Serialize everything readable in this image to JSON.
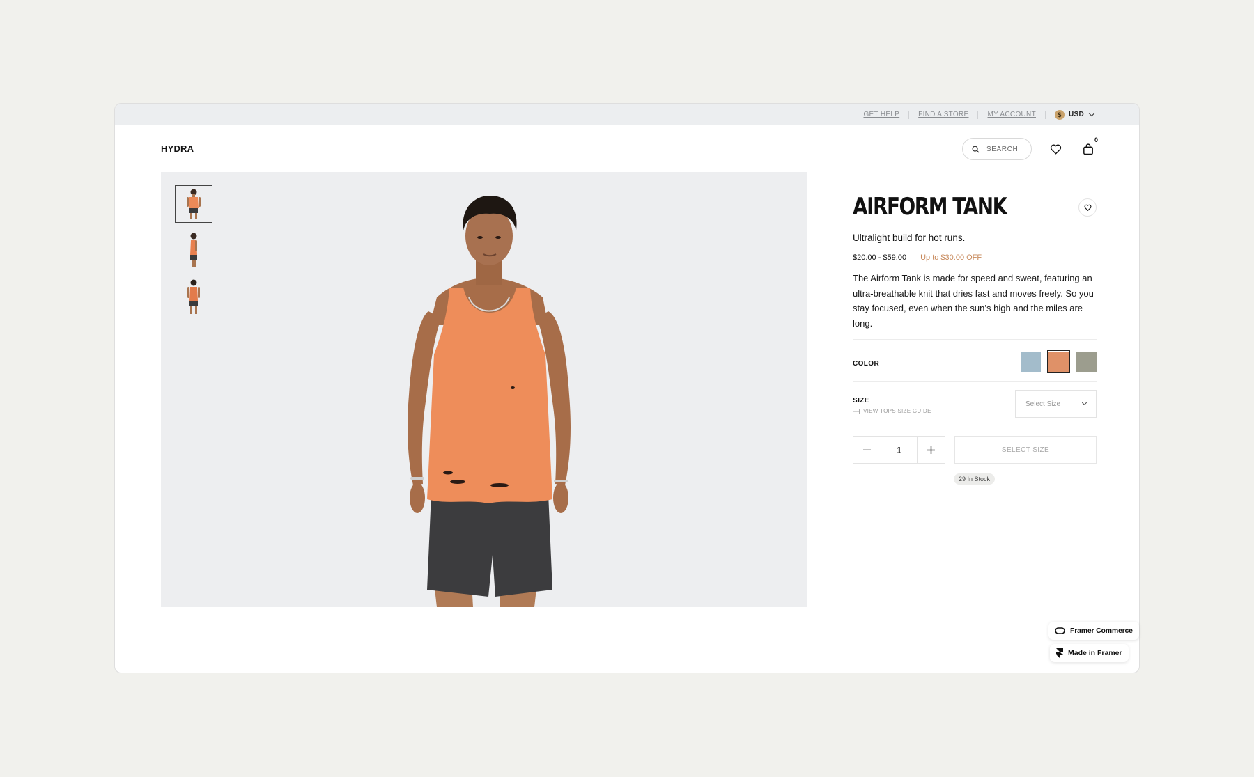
{
  "utility_bar": {
    "links": [
      "GET HELP",
      "FIND A STORE",
      "MY ACCOUNT"
    ],
    "currency_symbol": "$",
    "currency": "USD"
  },
  "header": {
    "logo": "HYDRA",
    "search_label": "SEARCH",
    "cart_count": "0"
  },
  "gallery": {
    "thumbnails": [
      "front-view",
      "side-view",
      "back-view"
    ],
    "active_thumbnail": 0
  },
  "product": {
    "title": "AIRFORM TANK",
    "subtitle": "Ultralight build for hot runs.",
    "price": "$20.00 - $59.00",
    "discount": "Up to $30.00 OFF",
    "description": "The Airform Tank is made for speed and sweat, featuring an ultra-breathable knit that dries fast and moves freely. So you stay focused, even when the sun’s high and the miles are long.",
    "color_label": "COLOR",
    "colors": [
      {
        "name": "blue",
        "hex": "#a3bccb",
        "selected": false
      },
      {
        "name": "orange",
        "hex": "#df9168",
        "selected": true
      },
      {
        "name": "olive",
        "hex": "#9c9d8e",
        "selected": false
      }
    ],
    "size_label": "SIZE",
    "size_guide": "VIEW TOPS SIZE GUIDE",
    "size_placeholder": "Select Size",
    "quantity": "1",
    "add_button": "SELECT SIZE",
    "stock": "29 In Stock"
  },
  "badges": {
    "commerce": "Framer Commerce",
    "made": "Made in Framer"
  },
  "colors": {
    "accent_discount": "#c7885a",
    "gallery_bg": "#edeef0",
    "page_bg": "#f1f1ed"
  }
}
